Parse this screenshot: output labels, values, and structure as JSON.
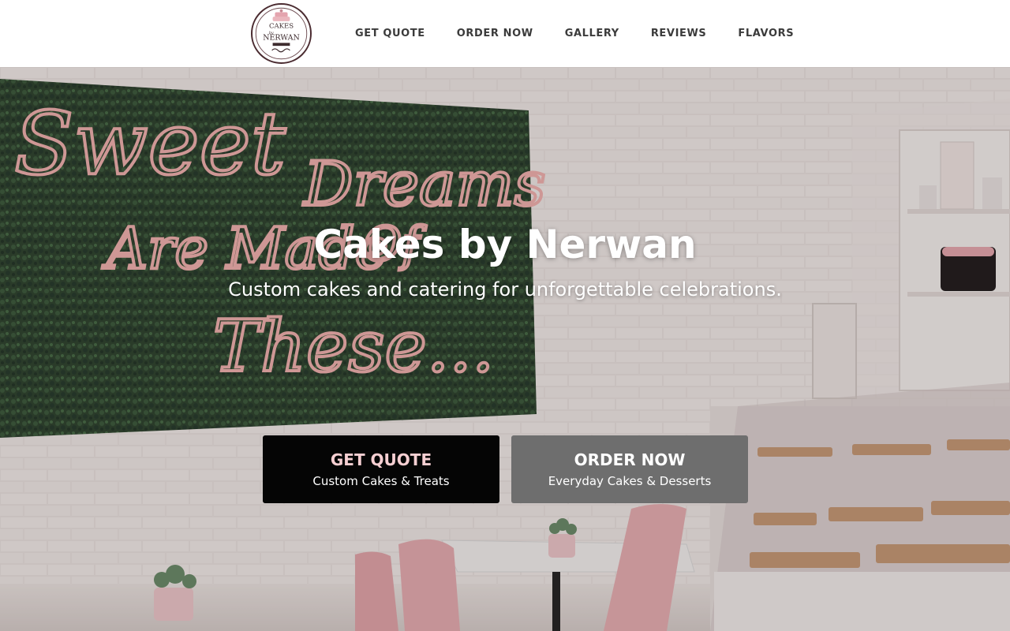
{
  "brand": {
    "logo_icon": "cakes-by-nerwan-logo",
    "logo_text_top": "CAKES",
    "logo_text_by": "by",
    "logo_text_bottom": "NERWAN"
  },
  "nav": {
    "items": [
      {
        "label": "GET QUOTE"
      },
      {
        "label": "ORDER NOW"
      },
      {
        "label": "GALLERY"
      },
      {
        "label": "REVIEWS"
      },
      {
        "label": "FLAVORS"
      }
    ]
  },
  "hero": {
    "title": "Cakes by Nerwan",
    "subtitle": "Custom cakes and catering for unforgettable celebrations.",
    "neon_sign": [
      "Sweet",
      "Dreams",
      "Are Made",
      "Of",
      "These..."
    ]
  },
  "ctas": [
    {
      "title": "GET QUOTE",
      "subtitle": "Custom Cakes & Treats"
    },
    {
      "title": "ORDER NOW",
      "subtitle": "Everyday Cakes & Desserts"
    }
  ],
  "colors": {
    "nav_bg": "#ffffff",
    "nav_text": "#3b3b3b",
    "cta_quote_bg": "#050505",
    "cta_quote_title": "#f6cfd2",
    "cta_order_bg": "#6e6e6e",
    "hedge_green": "#2f4a31",
    "neon_pink": "#f3b3b0"
  }
}
